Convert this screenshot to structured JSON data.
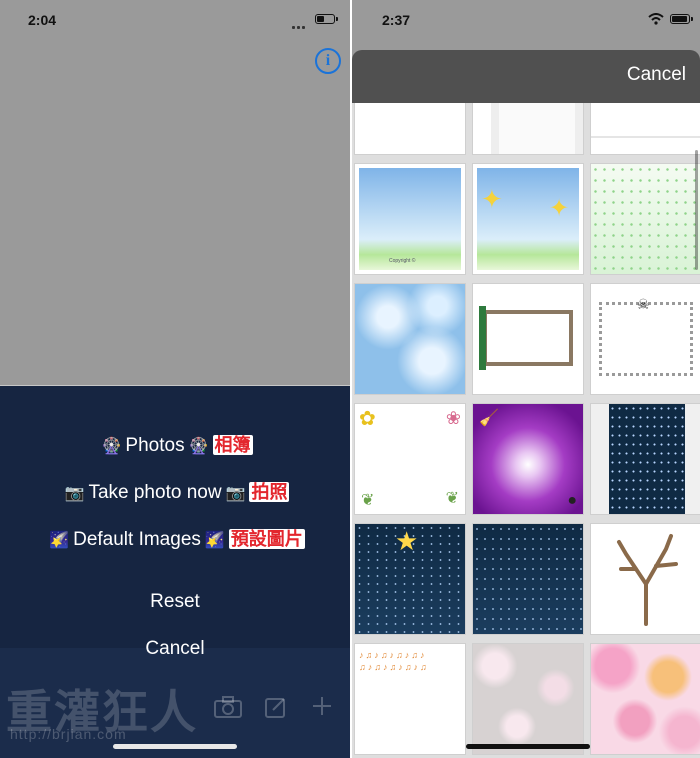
{
  "left": {
    "status_time": "2:04",
    "info_icon": "info-circle-icon",
    "menu": [
      {
        "glyph_name": "ferris-wheel-icon",
        "glyph": "🎡",
        "label": "Photos",
        "annotation": "相簿"
      },
      {
        "glyph_name": "camera-icon",
        "glyph": "📷",
        "label": "Take photo now",
        "annotation": "拍照"
      },
      {
        "glyph_name": "picture-icon",
        "glyph": "🌠",
        "label": "Default Images",
        "annotation": "預設圖片"
      }
    ],
    "reset_label": "Reset",
    "cancel_label": "Cancel",
    "watermark": "重灌狂人",
    "watermark_url": "http://brjian.com"
  },
  "right": {
    "status_time": "2:37",
    "cancel_label": "Cancel",
    "thumbnails": [
      {
        "name": "blank-white"
      },
      {
        "name": "blank-white-2"
      },
      {
        "name": "blank-white-3"
      },
      {
        "name": "sky-grass",
        "caption": "Copyright ©"
      },
      {
        "name": "sky-sparkles"
      },
      {
        "name": "green-confetti"
      },
      {
        "name": "blue-clouds"
      },
      {
        "name": "wooden-frame"
      },
      {
        "name": "bone-frame"
      },
      {
        "name": "flower-corners"
      },
      {
        "name": "purple-witch"
      },
      {
        "name": "night-stars"
      },
      {
        "name": "night-star"
      },
      {
        "name": "night-dots"
      },
      {
        "name": "bare-tree"
      },
      {
        "name": "music-notes"
      },
      {
        "name": "roses"
      },
      {
        "name": "pink-flowers"
      }
    ]
  },
  "colors": {
    "sheet_bg": "#162541",
    "accent_blue": "#1a73d9",
    "annotation_red": "#e3262d"
  }
}
